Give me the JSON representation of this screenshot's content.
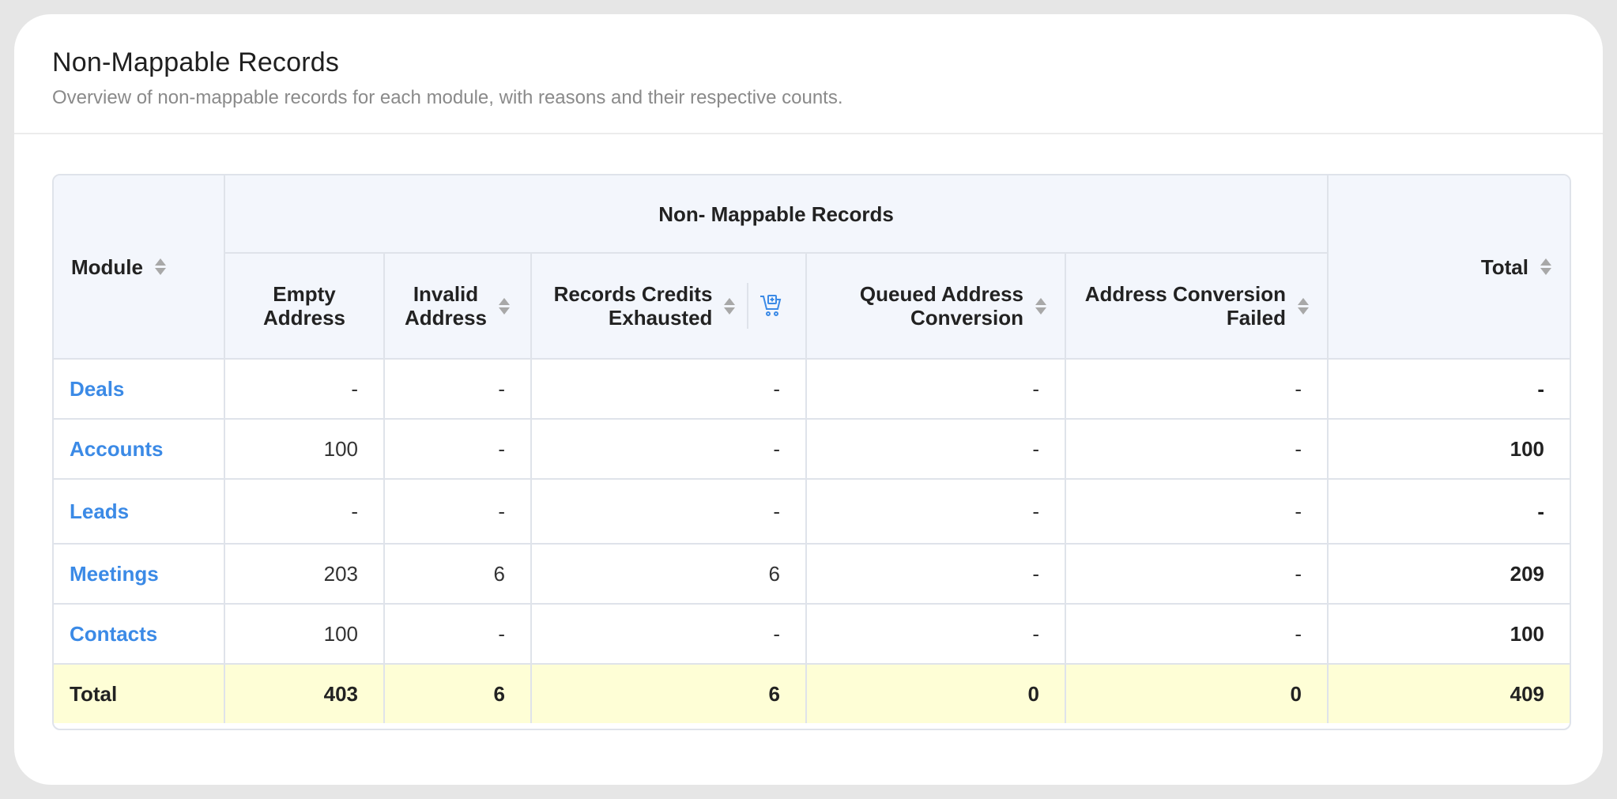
{
  "header": {
    "title": "Non-Mappable Records",
    "subtitle": "Overview of non-mappable records for each module, with reasons and their respective counts."
  },
  "table": {
    "group_header": "Non- Mappable Records",
    "columns": {
      "module": "Module",
      "empty_line1": "Empty",
      "empty_line2": "Address",
      "invalid_line1": "Invalid",
      "invalid_line2": "Address",
      "credits_line1": "Records Credits",
      "credits_line2": "Exhausted",
      "queued_line1": "Queued Address",
      "queued_line2": "Conversion",
      "failed_line1": "Address Conversion",
      "failed_line2": "Failed",
      "total": "Total"
    },
    "rows": [
      {
        "module": "Deals",
        "empty": "-",
        "invalid": "-",
        "credits": "-",
        "queued": "-",
        "failed": "-",
        "total": "-"
      },
      {
        "module": "Accounts",
        "empty": "100",
        "invalid": "-",
        "credits": "-",
        "queued": "-",
        "failed": "-",
        "total": "100"
      },
      {
        "module": "Leads",
        "empty": "-",
        "invalid": "-",
        "credits": "-",
        "queued": "-",
        "failed": "-",
        "total": "-"
      },
      {
        "module": "Meetings",
        "empty": "203",
        "invalid": "6",
        "credits": "6",
        "queued": "-",
        "failed": "-",
        "total": "209"
      },
      {
        "module": "Contacts",
        "empty": "100",
        "invalid": "-",
        "credits": "-",
        "queued": "-",
        "failed": "-",
        "total": "100"
      }
    ],
    "totals": {
      "label": "Total",
      "empty": "403",
      "invalid": "6",
      "credits": "6",
      "queued": "0",
      "failed": "0",
      "total": "409"
    }
  },
  "colors": {
    "link": "#3b8ae6",
    "header_bg": "#f3f6fc",
    "total_row_bg": "#fefed6",
    "border": "#dfe3ea"
  },
  "icons": {
    "sort": "sort-icon",
    "cart": "add-to-cart-icon"
  }
}
